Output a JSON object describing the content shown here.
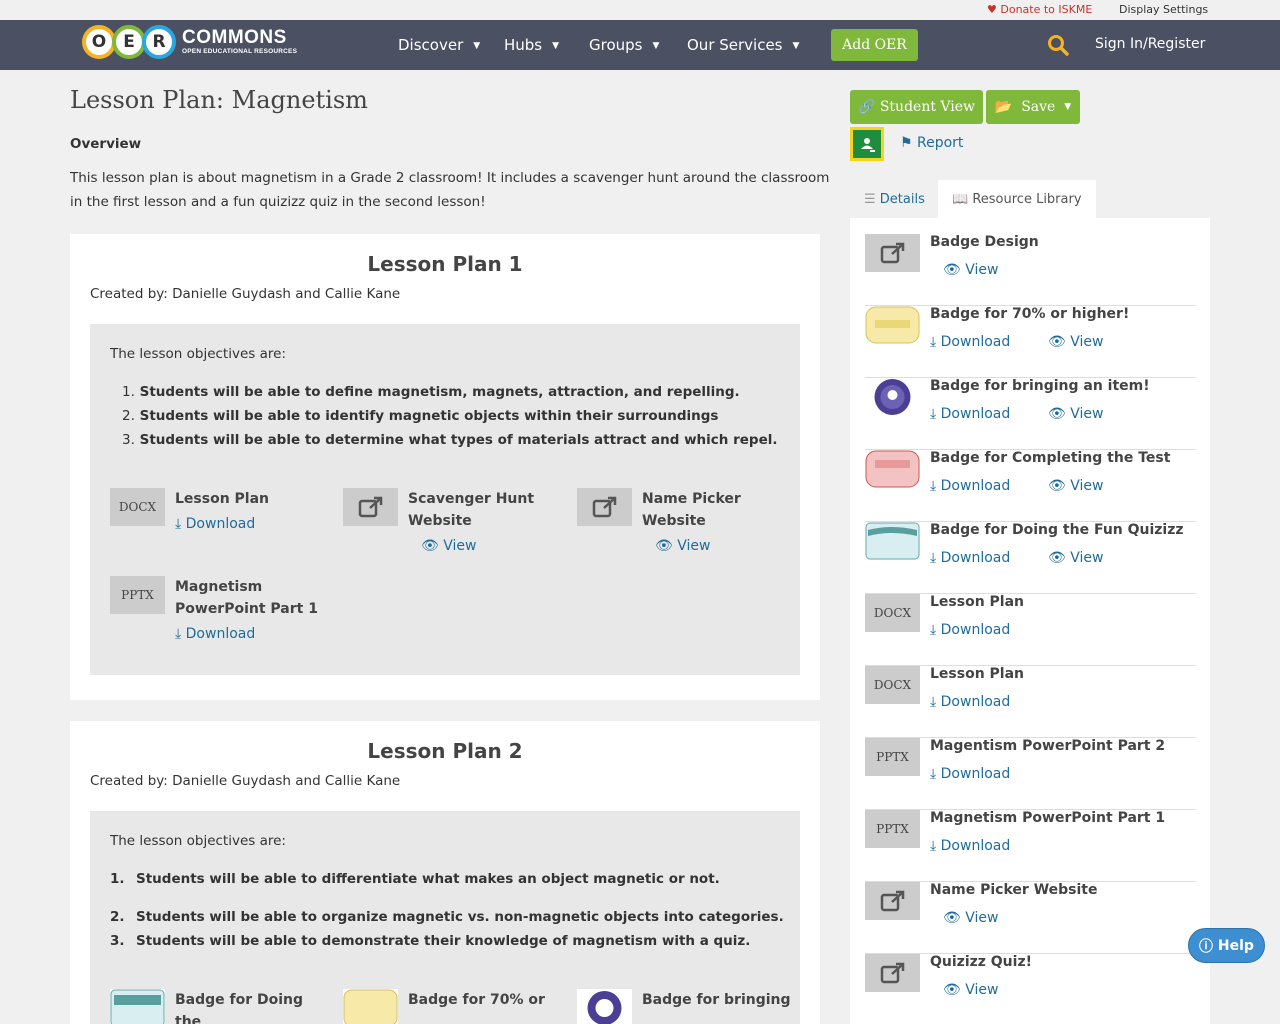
{
  "topbar": {
    "donate": "Donate to ISKME",
    "display_settings": "Display Settings"
  },
  "logo": {
    "letters": [
      "O",
      "E",
      "R"
    ],
    "name": "COMMONS",
    "tagline": "OPEN EDUCATIONAL RESOURCES"
  },
  "nav": {
    "discover": "Discover",
    "hubs": "Hubs",
    "groups": "Groups",
    "services": "Our Services",
    "add_oer": "Add OER",
    "signin": "Sign In/Register"
  },
  "page": {
    "title": "Lesson Plan: Magnetism",
    "overview_heading": "Overview",
    "overview_text": "This lesson plan is about magnetism in a Grade 2 classroom! It includes a scavenger hunt around the classroom in the first lesson and a fun quizizz quiz in the second lesson!"
  },
  "lesson1": {
    "title": "Lesson Plan 1",
    "created": "Created by: Danielle Guydash and Callie Kane",
    "intro": "The lesson objectives are:",
    "objectives": [
      "Students will be able to define magnetism, magnets, attraction, and repelling.",
      "Students will be able to identify magnetic objects within their surroundings",
      "Students will be able to determine what types of materials attract and which repel."
    ],
    "resources": [
      {
        "thumb": "DOCX",
        "title": "Lesson Plan",
        "action": "Download"
      },
      {
        "title": "Scavenger Hunt Website",
        "action": "View"
      },
      {
        "title": "Name Picker Website",
        "action": "View"
      },
      {
        "thumb": "PPTX",
        "title": "Magnetism PowerPoint Part 1",
        "action": "Download"
      }
    ]
  },
  "lesson2": {
    "title": "Lesson Plan 2",
    "created": "Created by: Danielle Guydash and Callie Kane",
    "intro": "The lesson objectives are:",
    "objectives": [
      "Students will be able to differentiate what makes an object magnetic or not.",
      "Students will be able to organize magnetic vs. non-magnetic objects into categories.",
      "Students will be able to demonstrate their knowledge of magnetism with a quiz."
    ],
    "nums": [
      "1.",
      "2.",
      "3."
    ],
    "resources": [
      {
        "title": "Badge for Doing the"
      },
      {
        "title": "Badge for 70% or"
      },
      {
        "title": "Badge for bringing"
      }
    ]
  },
  "sidebar": {
    "student_view": "Student View",
    "save": "Save",
    "report": "Report",
    "tab_details": "Details",
    "tab_library": "Resource Library",
    "items": [
      {
        "title": "Badge Design",
        "thumb": "link",
        "view": "View"
      },
      {
        "title": "Badge for 70% or higher!",
        "thumb": "badge-yellow",
        "download": "Download",
        "view": "View"
      },
      {
        "title": "Badge for bringing an item!",
        "thumb": "badge-purple",
        "download": "Download",
        "view": "View"
      },
      {
        "title": "Badge for Completing the Test",
        "thumb": "badge-red",
        "download": "Download",
        "view": "View"
      },
      {
        "title": "Badge for Doing the Fun Quizizz",
        "thumb": "badge-teal",
        "download": "Download",
        "view": "View"
      },
      {
        "title": "Lesson Plan",
        "thumb": "DOCX",
        "download": "Download"
      },
      {
        "title": "Lesson Plan",
        "thumb": "DOCX",
        "download": "Download"
      },
      {
        "title": "Magentism PowerPoint Part 2",
        "thumb": "PPTX",
        "download": "Download"
      },
      {
        "title": "Magnetism PowerPoint Part 1",
        "thumb": "PPTX",
        "download": "Download"
      },
      {
        "title": "Name Picker Website",
        "thumb": "link",
        "view": "View"
      },
      {
        "title": "Quizizz Quiz!",
        "thumb": "link",
        "view": "View"
      }
    ]
  },
  "help": "Help",
  "colors": {
    "nav_bg": "#4b5062",
    "green": "#7fb83a",
    "link": "#1f6c99"
  }
}
